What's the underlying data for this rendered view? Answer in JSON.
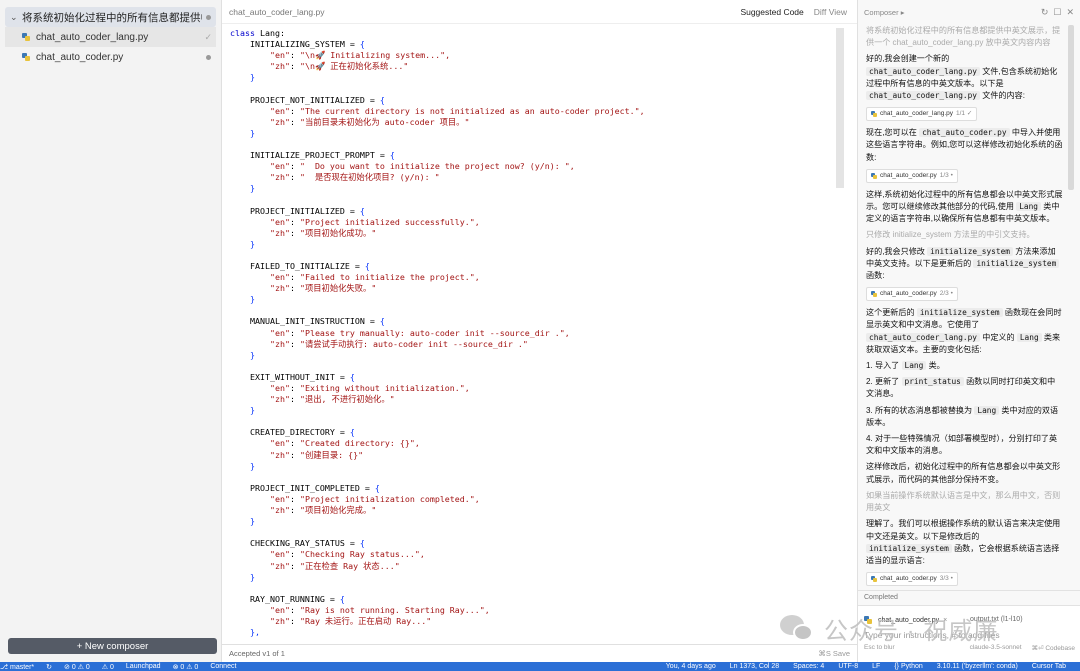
{
  "sidebar": {
    "group_title": "将系统初始化过程中的所有信息都提供中英文展…",
    "files": [
      {
        "name": "chat_auto_coder_lang.py",
        "active": true,
        "status": "check"
      },
      {
        "name": "chat_auto_coder.py",
        "active": false,
        "status": "dot"
      }
    ],
    "new_composer": "+ New composer"
  },
  "editor": {
    "filename": "chat_auto_coder_lang.py",
    "tab_suggested": "Suggested Code",
    "tab_diff": "Diff View",
    "footer_accepted": "Accepted v1 of 1",
    "footer_save": "⌘S Save",
    "code": {
      "class_line": "class Lang:",
      "blocks": [
        {
          "name": "INITIALIZING_SYSTEM",
          "en": "\"\\n🚀 Initializing system...\",",
          "zh": "\"\\n🚀 正在初始化系统...\""
        },
        {
          "name": "PROJECT_NOT_INITIALIZED",
          "en": "\"The current directory is not initialized as an auto-coder project.\",",
          "zh": "\"当前目录未初始化为 auto-coder 项目。\""
        },
        {
          "name": "INITIALIZE_PROJECT_PROMPT",
          "en": "\"  Do you want to initialize the project now? (y/n): \",",
          "zh": "\"  是否现在初始化项目? (y/n): \""
        },
        {
          "name": "PROJECT_INITIALIZED",
          "en": "\"Project initialized successfully.\",",
          "zh": "\"项目初始化成功。\""
        },
        {
          "name": "FAILED_TO_INITIALIZE",
          "en": "\"Failed to initialize the project.\",",
          "zh": "\"项目初始化失败。\""
        },
        {
          "name": "MANUAL_INIT_INSTRUCTION",
          "en": "\"Please try manually: auto-coder init --source_dir .\",",
          "zh": "\"请尝试手动执行: auto-coder init --source_dir .\""
        },
        {
          "name": "EXIT_WITHOUT_INIT",
          "en": "\"Exiting without initialization.\",",
          "zh": "\"退出, 不进行初始化。\""
        },
        {
          "name": "CREATED_DIRECTORY",
          "en": "\"Created directory: {}\",",
          "zh": "\"创建目录: {}\""
        },
        {
          "name": "PROJECT_INIT_COMPLETED",
          "en": "\"Project initialization completed.\",",
          "zh": "\"项目初始化完成。\""
        },
        {
          "name": "CHECKING_RAY_STATUS",
          "en": "\"Checking Ray status...\",",
          "zh": "\"正在检查 Ray 状态...\""
        },
        {
          "name": "RAY_NOT_RUNNING",
          "en": "\"Ray is not running. Starting Ray...\",",
          "zh": "\"Ray 未运行。正在启动 Ray...\""
        }
      ],
      "tail": "},"
    }
  },
  "composer": {
    "header_title": "Composer",
    "header_arrow": "▸",
    "icons": [
      "↻",
      "☐",
      "✕"
    ],
    "prompt1": "将系统初始化过程中的所有信息都提供中英文展示，提供一个 chat_auto_coder_lang.py 放中英文内容内容",
    "r1_a": "好的,我会创建一个新的",
    "r1_code1": "chat_auto_coder_lang.py",
    "r1_b": "文件,包含系统初始化过程中所有信息的中英文版本。以下是",
    "r1_code2": "chat_auto_coder_lang.py",
    "r1_c": "文件的内容:",
    "chip1": {
      "name": "chat_auto_coder_lang.py",
      "count": "1/1 ✓"
    },
    "r2_a": "现在,您可以在",
    "r2_code": "chat_auto_coder.py",
    "r2_b": "中导入并使用这些语言字符串。例如,您可以这样修改初始化系统的函数:",
    "chip2": {
      "name": "chat_auto_coder.py",
      "count": "1/3 •"
    },
    "r3_a": "这样,系统初始化过程中的所有信息都会以中英文形式展示。您可以继续修改其他部分的代码,使用",
    "r3_code": "Lang",
    "r3_b": "类中定义的语言字符串,以确保所有信息都有中英文版本。",
    "prompt2": "只修改 initialize_system 方法里的中引文支持。",
    "r4_a": "好的,我会只修改",
    "r4_code1": "initialize_system",
    "r4_b": "方法来添加中英文支持。以下是更新后的",
    "r4_code2": "initialize_system",
    "r4_c": "函数:",
    "chip3": {
      "name": "chat_auto_coder.py",
      "count": "2/3 •"
    },
    "r5_a": "这个更新后的",
    "r5_code1": "initialize_system",
    "r5_b": "函数现在会同时显示英文和中文消息。它使用了",
    "r5_code2": "chat_auto_coder_lang.py",
    "r5_c": "中定义的",
    "r5_code3": "Lang",
    "r5_d": "类来获取双语文本。主要的变化包括:",
    "li1_a": "1. 导入了",
    "li1_code": "Lang",
    "li1_b": "类。",
    "li2_a": "2. 更新了",
    "li2_code": "print_status",
    "li2_b": "函数以同时打印英文和中文消息。",
    "li3_a": "3. 所有的状态消息都被替换为",
    "li3_code": "Lang",
    "li3_b": "类中对应的双语版本。",
    "li4": "4. 对于一些特殊情况（如部署模型时），分别打印了英文和中文版本的消息。",
    "r6": "这样修改后，初始化过程中的所有信息都会以中英文形式展示，而代码的其他部分保持不变。",
    "prompt3": "如果当前操作系统默认语言是中文，那么用中文，否则用英文",
    "r7_a": "理解了。我们可以根据操作系统的默认语言来决定使用中文还是英文。以下是修改后的",
    "r7_code": "initialize_system",
    "r7_b": "函数，它会根据系统语言选择适当的显示语言:",
    "chip4": {
      "name": "chat_auto_coder.py",
      "count": "3/3 •"
    },
    "completed": "Completed",
    "input_chip1": "chat_auto_coder.py",
    "input_chip2": "output.txt (l1-l10)",
    "input_placeholder": "Type your instructions, # to add files",
    "foot_esc": "Esc to blur",
    "foot_model": "claude-3.5-sonnet",
    "foot_codebase": "⌘⏎ Codebase"
  },
  "watermark": "公众号 · 祝威廉",
  "statusbar": {
    "left": [
      "⎇ master*",
      "↻",
      "⊘ 0 ⚠ 0",
      "⚠ 0",
      "Launchpad",
      "⊗ 0 ⚠ 0",
      "Connect"
    ],
    "right": [
      "You, 4 days ago",
      "Ln 1373, Col 28",
      "Spaces: 4",
      "UTF-8",
      "LF",
      "{} Python",
      "3.10.11 ('byzerllm': conda)",
      "Cursor Tab"
    ]
  }
}
